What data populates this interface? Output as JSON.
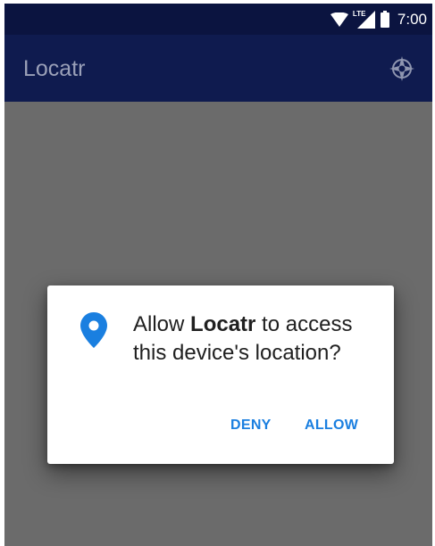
{
  "status_bar": {
    "network_label": "LTE",
    "time": "7:00"
  },
  "app_bar": {
    "title": "Locatr",
    "action_icon": "compass-icon"
  },
  "dialog": {
    "icon": "location-pin-icon",
    "message_prefix": "Allow ",
    "message_app": "Locatr",
    "message_suffix": " to access this device's location?",
    "deny_label": "DENY",
    "allow_label": "ALLOW"
  },
  "colors": {
    "status_bar": "#0b1440",
    "app_bar": "#0f1b4f",
    "scrim": "#6b6b6b",
    "accent": "#1a7fe0",
    "dialog_bg": "#ffffff"
  }
}
